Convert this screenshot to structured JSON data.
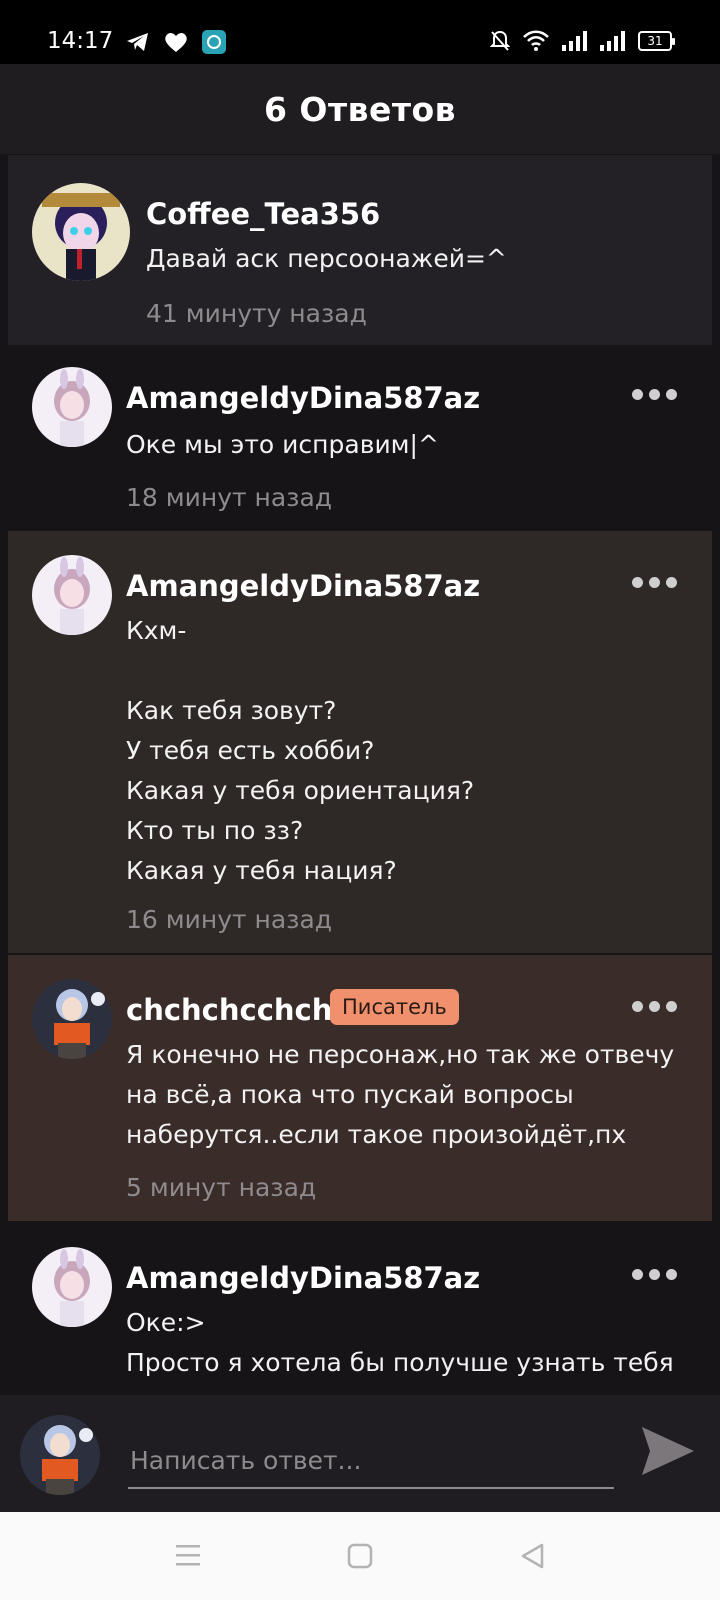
{
  "status_bar": {
    "time": "14:17",
    "battery": "31",
    "left_icons": [
      "telegram-icon",
      "heart-icon",
      "app-icon"
    ],
    "right_icons": [
      "mute-icon",
      "wifi-icon",
      "signal-icon",
      "signal-icon-2",
      "battery-icon"
    ]
  },
  "header": {
    "title": "6 Ответов"
  },
  "comments": [
    {
      "author": "Coffee_Tea356",
      "text": "Давай аск персоонажей=^",
      "time": "41 минуту назад"
    },
    {
      "author": "AmangeldyDina587az",
      "text": "Оке мы это исправим|^",
      "time": "18 минут назад"
    },
    {
      "author": "AmangeldyDina587az",
      "text": "Кхм-\n\nКак тебя зовут?\nУ тебя есть хобби?\nКакая у тебя ориентация?\nКто ты по зз?\nКакая у тебя нация?",
      "time": "16 минут назад"
    },
    {
      "author": "chchchcchch",
      "badge": "Писатель",
      "text": "Я конечно не персонаж,но так же отвечу\nна всё,а пока что пускай вопросы\nнаберутся..если такое произойдёт,пх",
      "time": "5 минут назад"
    },
    {
      "author": "AmangeldyDina587az",
      "text": "Оке:>\nПросто я хотела бы получше узнать тебя",
      "time": ""
    }
  ],
  "reply": {
    "placeholder": "Написать ответ..."
  },
  "colors": {
    "badge": "#f0906c",
    "background": "#161417"
  }
}
